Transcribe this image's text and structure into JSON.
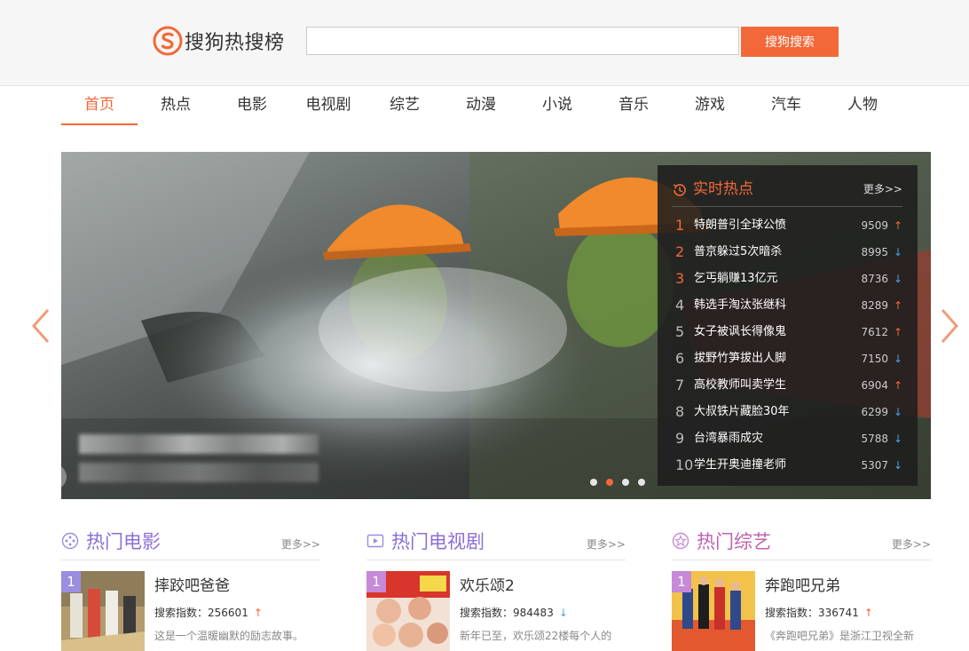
{
  "header": {
    "logo_text": "搜狗热搜榜",
    "search_placeholder": "",
    "search_button": "搜狗搜索"
  },
  "nav": [
    {
      "label": "首页",
      "active": true
    },
    {
      "label": "热点"
    },
    {
      "label": "电影"
    },
    {
      "label": "电视剧"
    },
    {
      "label": "综艺"
    },
    {
      "label": "动漫"
    },
    {
      "label": "小说"
    },
    {
      "label": "音乐"
    },
    {
      "label": "游戏"
    },
    {
      "label": "汽车"
    },
    {
      "label": "人物"
    }
  ],
  "banner": {
    "active_dot": 1,
    "dot_count": 4
  },
  "hot": {
    "title": "实时热点",
    "more": "更多>>",
    "items": [
      {
        "rank": "1",
        "name": "特朗普引全球公愤",
        "count": "9509",
        "trend": "up"
      },
      {
        "rank": "2",
        "name": "普京躲过5次暗杀",
        "count": "8995",
        "trend": "down"
      },
      {
        "rank": "3",
        "name": "乞丐躺赚13亿元",
        "count": "8736",
        "trend": "down"
      },
      {
        "rank": "4",
        "name": "韩选手淘汰张继科",
        "count": "8289",
        "trend": "up"
      },
      {
        "rank": "5",
        "name": "女子被讽长得像鬼",
        "count": "7612",
        "trend": "up"
      },
      {
        "rank": "6",
        "name": "拔野竹笋拔出人脚",
        "count": "7150",
        "trend": "down"
      },
      {
        "rank": "7",
        "name": "高校教师叫卖学生",
        "count": "6904",
        "trend": "up"
      },
      {
        "rank": "8",
        "name": "大叔铁片藏脸30年",
        "count": "6299",
        "trend": "down"
      },
      {
        "rank": "9",
        "name": "台湾暴雨成灾",
        "count": "5788",
        "trend": "down"
      },
      {
        "rank": "10",
        "name": "学生开奥迪撞老师",
        "count": "5307",
        "trend": "down"
      }
    ]
  },
  "sections": {
    "movie": {
      "title": "热门电影",
      "more": "更多>>",
      "rank": "1",
      "name": "摔跤吧爸爸",
      "index_label": "搜索指数：",
      "index_value": "256601",
      "trend": "up",
      "desc": "这是一个温暖幽默的励志故事。"
    },
    "tv": {
      "title": "热门电视剧",
      "more": "更多>>",
      "rank": "1",
      "name": "欢乐颂2",
      "index_label": "搜索指数：",
      "index_value": "984483",
      "trend": "down",
      "desc": "新年已至，欢乐颂22楼每个人的"
    },
    "variety": {
      "title": "热门综艺",
      "more": "更多>>",
      "rank": "1",
      "name": "奔跑吧兄弟",
      "index_label": "搜索指数：",
      "index_value": "336741",
      "trend": "up",
      "desc": "《奔跑吧兄弟》是浙江卫视全新"
    }
  },
  "arrows": {
    "up": "↑",
    "down": "↓"
  },
  "colors": {
    "accent": "#f26838",
    "down": "#4aa3e0",
    "movie_title": "#8a6fd6",
    "variety_title": "#c062b0"
  }
}
